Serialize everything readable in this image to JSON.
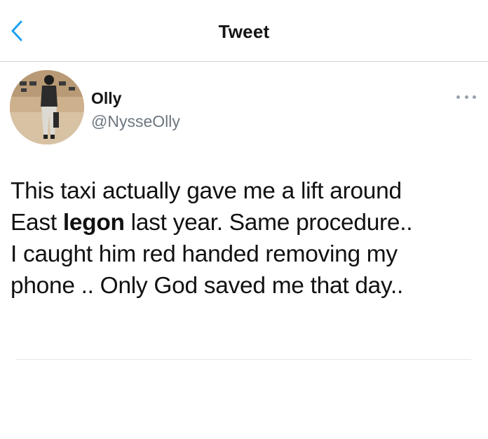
{
  "header": {
    "title": "Tweet",
    "back_icon": "chevron-left-icon"
  },
  "colors": {
    "accent": "#1da1f2",
    "text": "#0f1419",
    "secondary_text": "#6d7680",
    "divider": "#cfd4d8"
  },
  "tweet": {
    "author": {
      "name": "Olly",
      "handle": "@NysseOlly"
    },
    "more_icon": "more-dots-icon",
    "lines": [
      {
        "parts": [
          {
            "text": "This taxi actually gave me a lift around",
            "bold": false
          }
        ]
      },
      {
        "parts": [
          {
            "text": "East ",
            "bold": false
          },
          {
            "text": "legon",
            "bold": true
          },
          {
            "text": " last year. Same procedure..",
            "bold": false
          }
        ]
      },
      {
        "parts": [
          {
            "text": "I caught him red handed removing my",
            "bold": false
          }
        ]
      },
      {
        "parts": [
          {
            "text": "phone .. Only God saved me that day..",
            "bold": false
          }
        ]
      }
    ]
  }
}
